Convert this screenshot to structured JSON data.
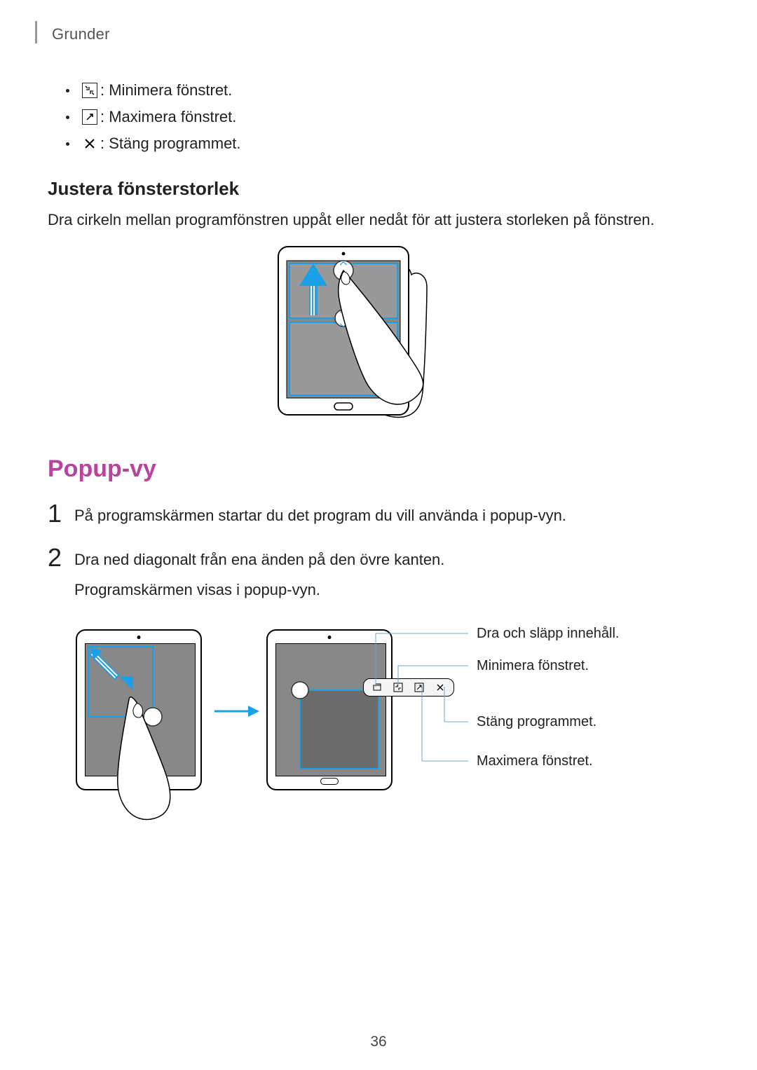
{
  "header": {
    "chapter": "Grunder"
  },
  "iconList": {
    "minimize": ": Minimera fönstret.",
    "maximize": ": Maximera fönstret.",
    "close": ": Stäng programmet."
  },
  "adjust": {
    "heading": "Justera fönsterstorlek",
    "body": "Dra cirkeln mellan programfönstren uppåt eller nedåt för att justera storleken på fönstren."
  },
  "popup": {
    "title": "Popup-vy",
    "step1": {
      "num": "1",
      "text": "På programskärmen startar du det program du vill använda i popup-vyn."
    },
    "step2": {
      "num": "2",
      "line1": "Dra ned diagonalt från ena änden på den övre kanten.",
      "line2": "Programskärmen visas i popup-vyn."
    },
    "callouts": {
      "drag": "Dra och släpp innehåll.",
      "min": "Minimera fönstret.",
      "close": "Stäng programmet.",
      "max": "Maximera fönstret."
    }
  },
  "pageNumber": "36"
}
